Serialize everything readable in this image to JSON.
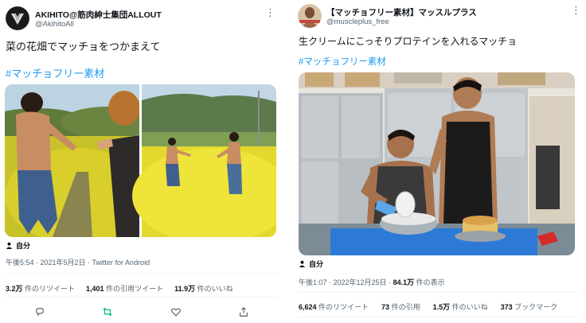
{
  "left": {
    "display_name": "AKIHITO@筋肉紳士集団ALLOUT",
    "handle": "@AkihitoAll",
    "text": "菜の花畑でマッチョをつかまえて",
    "hashtag": "#マッチョフリー素材",
    "tagged_person": "自分",
    "timestamp": "午後5:54 · 2021年5月2日 · Twitter for Android",
    "stats": [
      {
        "num": "3.2万",
        "label": " 件のリツイート"
      },
      {
        "num": "1,401",
        "label": " 件の引用ツイート"
      },
      {
        "num": "11.9万",
        "label": " 件のいいね"
      }
    ],
    "actions": [
      "reply-icon",
      "retweet-icon",
      "like-icon",
      "share-icon"
    ]
  },
  "right": {
    "display_name": "【マッチョフリー素材】マッスルプラス",
    "handle": "@muscleplus_free",
    "text": "生クリームにこっそりプロテインを入れるマッチョ",
    "hashtag": "#マッチョフリー素材",
    "tagged_person": "自分",
    "timestamp_prefix": "午後1:07 · 2022年12月25日 · ",
    "views_num": "84.1万",
    "views_label": " 件の表示",
    "stats": [
      {
        "num": "6,624",
        "label": " 件のリツイート"
      },
      {
        "num": "73",
        "label": " 件の引用"
      },
      {
        "num": "1.5万",
        "label": " 件のいいね"
      },
      {
        "num": "373",
        "label": " ブックマーク"
      }
    ]
  },
  "colors": {
    "link": "#1d9bf0",
    "retweet": "#00ba7c",
    "secondary_text": "#536471"
  }
}
